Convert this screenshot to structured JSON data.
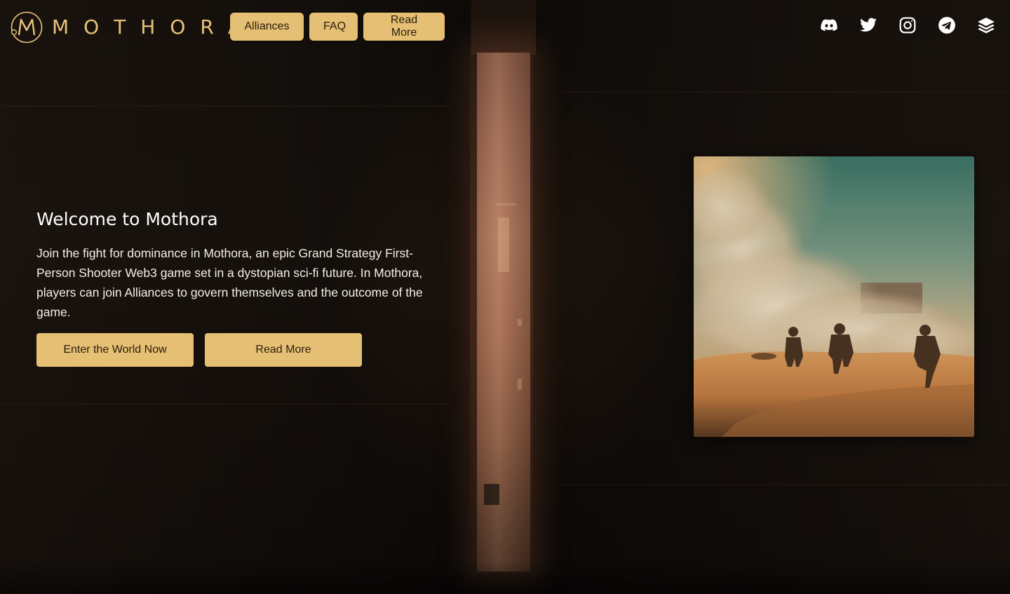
{
  "brand": {
    "name": "MOTHORA",
    "accent_color": "#e5bf73"
  },
  "nav": {
    "items": [
      {
        "label": "Alliances"
      },
      {
        "label": "FAQ"
      },
      {
        "label": "Read More"
      }
    ]
  },
  "socials": [
    {
      "icon": "discord-icon"
    },
    {
      "icon": "twitter-icon"
    },
    {
      "icon": "instagram-icon"
    },
    {
      "icon": "telegram-icon"
    },
    {
      "icon": "layers-icon"
    }
  ],
  "hero": {
    "title": "Welcome to Mothora",
    "description": "Join the fight for dominance in Mothora, an epic Grand Strategy First-Person Shooter Web3 game set in a dystopian sci-fi future. In Mothora, players can join Alliances to govern themselves and the outcome of the game.",
    "primary_button": "Enter the World Now",
    "secondary_button": "Read More"
  },
  "artwork": {
    "subject": "soldiers-walking-through-desert-sandstorm"
  }
}
